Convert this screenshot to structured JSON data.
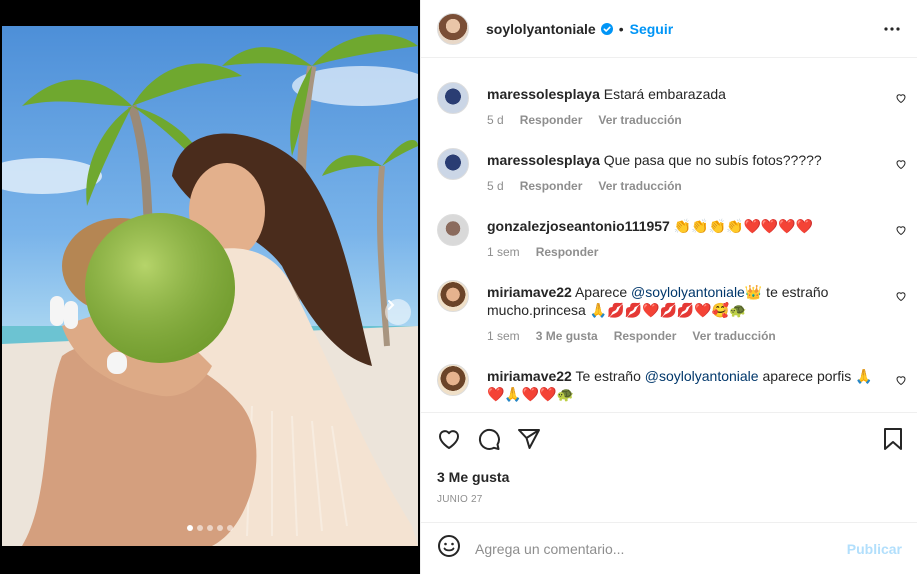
{
  "post": {
    "username": "soylolyantoniale",
    "separator": "•",
    "follow_label": "Seguir",
    "carousel": {
      "slide_count": 5,
      "active_slide": 1
    }
  },
  "comments": [
    {
      "username": "maressolesplaya",
      "text": "Estará embarazada",
      "age": "5 d",
      "reply_label": "Responder",
      "translate_label": "Ver traducción"
    },
    {
      "username": "maressolesplaya",
      "text": "Que pasa que no subís fotos?????",
      "age": "5 d",
      "reply_label": "Responder",
      "translate_label": "Ver traducción"
    },
    {
      "username": "gonzalezjoseantonio111957",
      "text": "👏👏👏👏❤️❤️❤️❤️",
      "age": "1 sem",
      "reply_label": "Responder"
    },
    {
      "username": "miriamave22",
      "text_before": "Aparece",
      "mention": "@soylolyantoniale",
      "text_after": "👑 te estraño mucho.princesa 🙏💋💋❤️💋💋❤️🥰🐢",
      "age": "1 sem",
      "likes": "3 Me gusta",
      "reply_label": "Responder",
      "translate_label": "Ver traducción"
    },
    {
      "username": "miriamave22",
      "text_before": "Te estraño",
      "mention": "@soylolyantoniale",
      "text_after": "aparece porfis 🙏 ❤️🙏❤️❤️🐢"
    }
  ],
  "actions": {
    "likes": "3 Me gusta",
    "date": "JUNIO 27"
  },
  "add_comment": {
    "placeholder": "Agrega un comentario...",
    "publish_label": "Publicar"
  },
  "colors": {
    "accent": "#0095f6",
    "mention": "#00376b",
    "muted": "#8e8e8e",
    "publish_disabled": "#b2dffc"
  }
}
